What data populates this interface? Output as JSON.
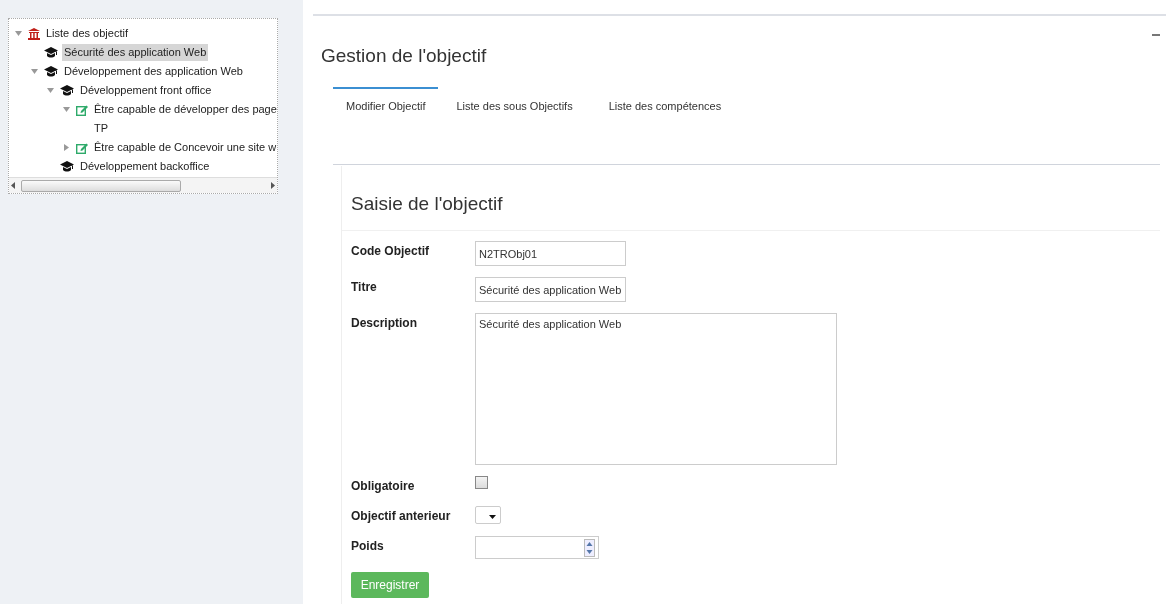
{
  "tree": {
    "label": "Liste des objectif",
    "kind": "root",
    "expanded": true,
    "selected": false,
    "children": [
      {
        "label": "Sécurité des application Web",
        "kind": "objective",
        "selected": true
      },
      {
        "label": "Développement des application Web",
        "kind": "objective",
        "expanded": true,
        "selected": false,
        "children": [
          {
            "label": "Développement front office",
            "kind": "objective",
            "expanded": true,
            "selected": false,
            "children": [
              {
                "label": "Être capable de développer des page",
                "kind": "skill",
                "expanded": true,
                "selected": false,
                "children": [
                  {
                    "label": "TP",
                    "selected": false
                  }
                ]
              },
              {
                "label": "Être capable de Concevoir une site w",
                "kind": "skill",
                "expanded": false,
                "selected": false
              }
            ]
          },
          {
            "label": "Développement backoffice",
            "kind": "objective",
            "selected": false
          }
        ]
      }
    ]
  },
  "page_title": "Gestion de l'objectif",
  "tabs": [
    {
      "label": "Modifier Objectif",
      "selected": true
    },
    {
      "label": "Liste des sous Objectifs",
      "selected": false
    },
    {
      "label": "Liste des compétences",
      "selected": false
    }
  ],
  "form": {
    "title": "Saisie de l'objectif",
    "fields": [
      {
        "kind": "text",
        "label": "Code Objectif",
        "value": "N2TRObj01"
      },
      {
        "kind": "text",
        "label": "Titre",
        "value": "Sécurité des application Web"
      },
      {
        "kind": "textarea",
        "label": "Description",
        "value": "Sécurité des application Web"
      },
      {
        "kind": "checkbox",
        "label": "Obligatoire",
        "checked": false
      },
      {
        "kind": "select",
        "label": "Objectif anterieur"
      },
      {
        "kind": "number",
        "label": "Poids"
      }
    ],
    "submit": "Enregistrer"
  }
}
